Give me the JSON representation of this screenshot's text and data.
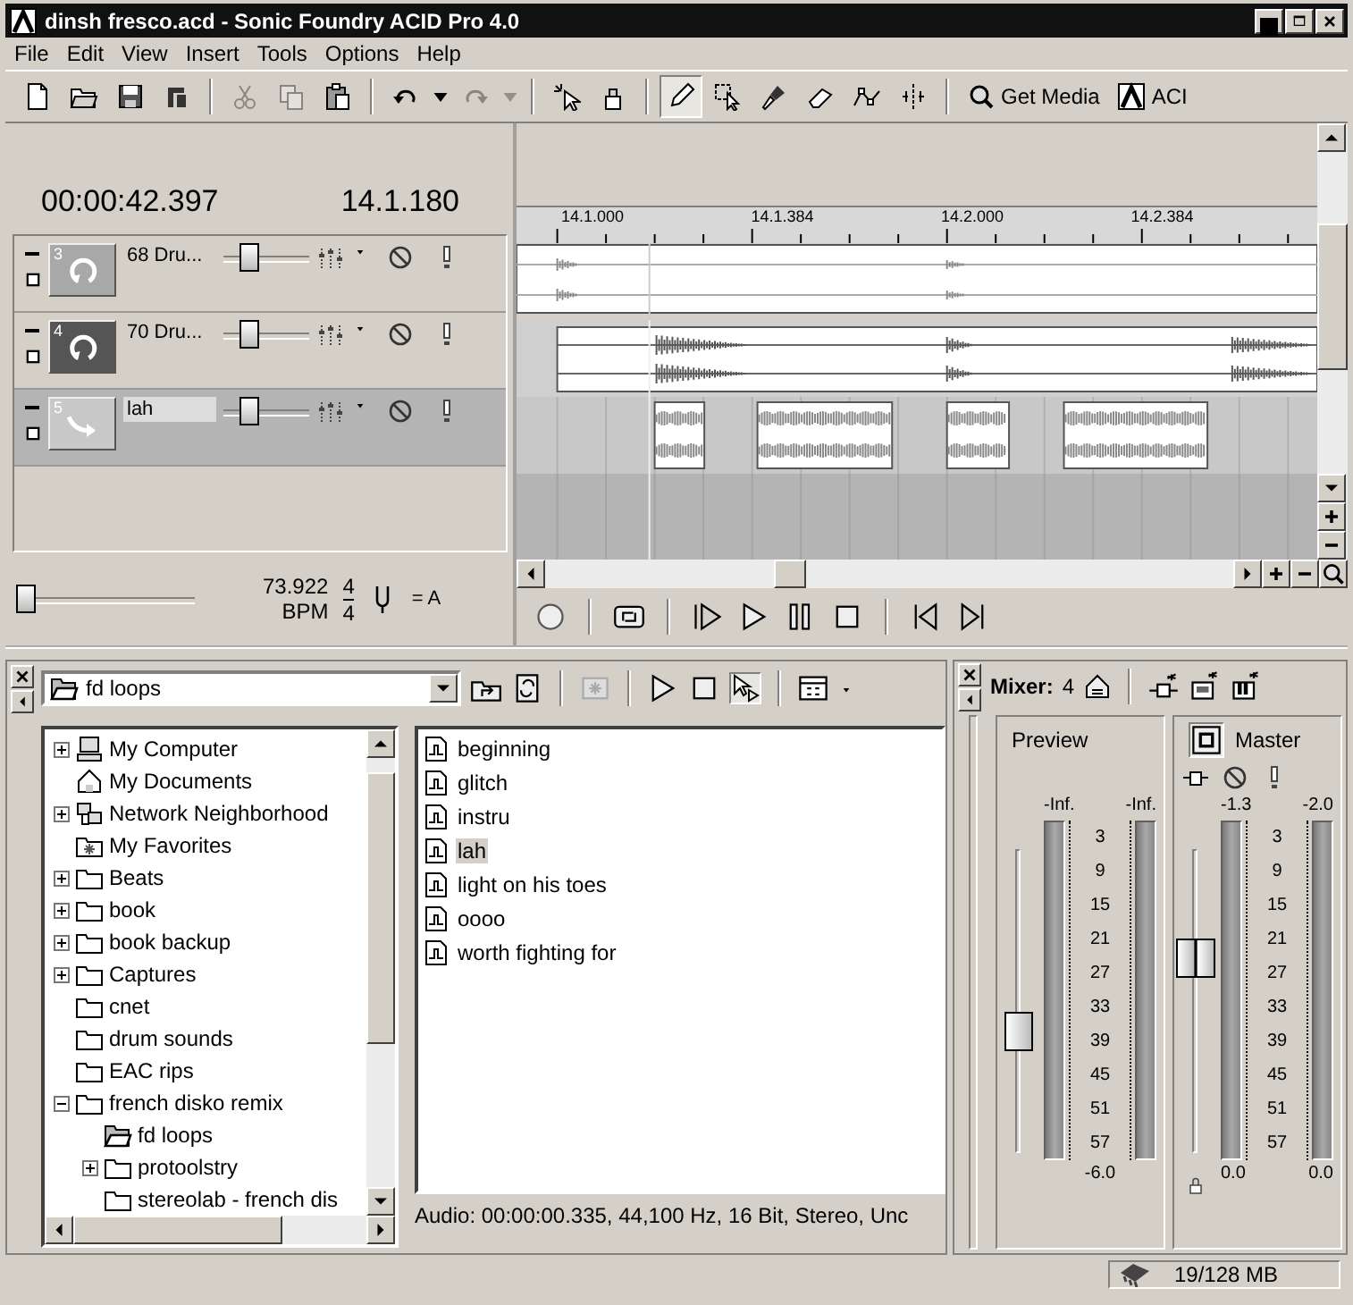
{
  "window": {
    "title": "dinsh fresco.acd - Sonic Foundry ACID Pro 4.0"
  },
  "menu": [
    {
      "label": "File"
    },
    {
      "label": "Edit"
    },
    {
      "label": "View"
    },
    {
      "label": "Insert"
    },
    {
      "label": "Tools"
    },
    {
      "label": "Options"
    },
    {
      "label": "Help"
    }
  ],
  "toolbar": [
    {
      "kind": "button",
      "selected": false,
      "disabled": false
    },
    {
      "kind": "button",
      "selected": false,
      "disabled": false
    },
    {
      "kind": "button",
      "selected": false,
      "disabled": false
    },
    {
      "kind": "button",
      "selected": false,
      "disabled": false
    },
    {
      "kind": "separator"
    },
    {
      "kind": "button",
      "selected": false,
      "disabled": true
    },
    {
      "kind": "button",
      "selected": false,
      "disabled": true
    },
    {
      "kind": "button",
      "selected": false,
      "disabled": false
    },
    {
      "kind": "separator"
    },
    {
      "kind": "button",
      "selected": false,
      "disabled": false
    },
    {
      "kind": "button",
      "selected": false,
      "disabled": false
    },
    {
      "kind": "button",
      "selected": false,
      "disabled": true
    },
    {
      "kind": "button",
      "selected": false,
      "disabled": true
    },
    {
      "kind": "separator"
    },
    {
      "kind": "button",
      "selected": false,
      "disabled": false
    },
    {
      "kind": "button",
      "selected": false,
      "disabled": false
    },
    {
      "kind": "separator"
    },
    {
      "kind": "button",
      "selected": true,
      "disabled": false
    },
    {
      "kind": "button",
      "selected": false,
      "disabled": false
    },
    {
      "kind": "button",
      "selected": false,
      "disabled": false
    },
    {
      "kind": "button",
      "selected": false,
      "disabled": false
    },
    {
      "kind": "button",
      "selected": false,
      "disabled": false
    },
    {
      "kind": "button",
      "selected": false,
      "disabled": false
    },
    {
      "kind": "separator"
    },
    {
      "kind": "button",
      "selected": false,
      "disabled": false,
      "label": "Get Media"
    },
    {
      "kind": "button",
      "selected": false,
      "disabled": false,
      "label": "ACI"
    }
  ],
  "time": {
    "position": "00:00:42.397",
    "measure": "14.1.180"
  },
  "tracks": [
    {
      "number": "3",
      "name": "68 Dru...",
      "kind": "loop",
      "selected": false,
      "highlighted": false,
      "editing": false,
      "level": 0.32
    },
    {
      "number": "4",
      "name": "70 Dru...",
      "kind": "loop",
      "selected": false,
      "highlighted": true,
      "editing": false,
      "level": 0.32
    },
    {
      "number": "5",
      "name": "lah",
      "kind": "oneshot",
      "selected": true,
      "highlighted": false,
      "editing": true,
      "level": 0.32
    }
  ],
  "tempo": {
    "level": 0.0,
    "bpm": "73.922",
    "bpm_label": "BPM",
    "beats": "4",
    "unit": "4",
    "key": "= A"
  },
  "ruler": [
    "14.1.000",
    "14.1.384",
    "14.2.000",
    "14.2.384"
  ],
  "explorer": {
    "location": "fd loops",
    "tree": [
      {
        "label": "My Computer",
        "kind": "collapsed",
        "selected": false
      },
      {
        "label": "My Documents",
        "kind": "leaf",
        "selected": false
      },
      {
        "label": "Network Neighborhood",
        "kind": "collapsed",
        "selected": false
      },
      {
        "label": "My Favorites",
        "kind": "leaf",
        "selected": false
      },
      {
        "label": "Beats",
        "kind": "collapsed",
        "selected": false
      },
      {
        "label": "book",
        "kind": "collapsed",
        "selected": false
      },
      {
        "label": "book backup",
        "kind": "collapsed",
        "selected": false
      },
      {
        "label": "Captures",
        "kind": "collapsed",
        "selected": false
      },
      {
        "label": "cnet",
        "kind": "leaf",
        "selected": false
      },
      {
        "label": "drum sounds",
        "kind": "leaf",
        "selected": false
      },
      {
        "label": "EAC rips",
        "kind": "leaf",
        "selected": false
      },
      {
        "label": "french disko remix",
        "kind": "expanded",
        "selected": false,
        "children": [
          {
            "label": "fd loops",
            "kind": "leaf",
            "selected": true
          },
          {
            "label": "protoolstry",
            "kind": "collapsed",
            "selected": false
          },
          {
            "label": "stereolab - french dis",
            "kind": "leaf",
            "selected": false
          }
        ]
      }
    ],
    "files": [
      {
        "label": "beginning",
        "selected": false
      },
      {
        "label": "glitch",
        "selected": false
      },
      {
        "label": "instru",
        "selected": false
      },
      {
        "label": "lah",
        "selected": true
      },
      {
        "label": "light on his toes",
        "selected": false
      },
      {
        "label": "oooo",
        "selected": false
      },
      {
        "label": "worth fighting for",
        "selected": false
      }
    ],
    "info": "Audio: 00:00:00.335, 44,100 Hz, 16 Bit, Stereo, Unc"
  },
  "mixer": {
    "title": "Mixer:",
    "count": "4",
    "channels": [
      {
        "kind": "preview",
        "name": "Preview",
        "peaks": [
          "-Inf.",
          "-Inf."
        ],
        "scale": [
          "3",
          "9",
          "15",
          "21",
          "27",
          "33",
          "39",
          "45",
          "51",
          "57"
        ],
        "footer": [
          "-6.0"
        ],
        "level": 0.4
      },
      {
        "kind": "master",
        "name": "Master",
        "peaks": [
          "-1.3",
          "-2.0"
        ],
        "scale": [
          "3",
          "9",
          "15",
          "21",
          "27",
          "33",
          "39",
          "45",
          "51",
          "57"
        ],
        "footer": [
          "0.0",
          "0.0"
        ],
        "level": 0.64
      }
    ]
  },
  "status": {
    "memory": "19/128 MB"
  }
}
